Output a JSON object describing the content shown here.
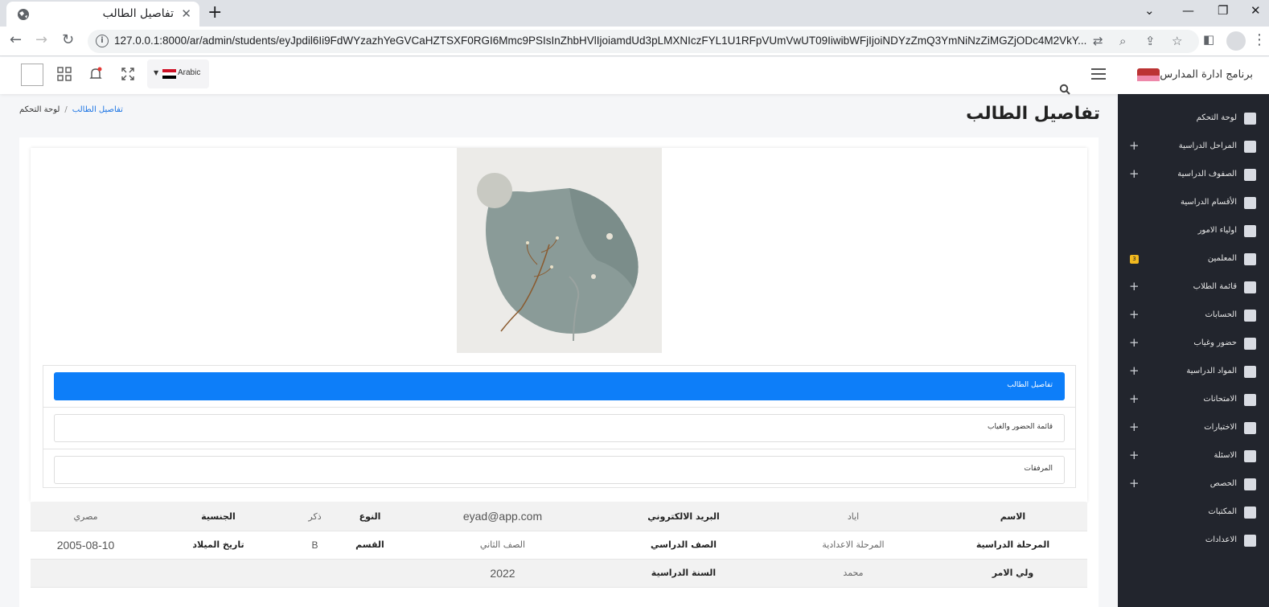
{
  "browser": {
    "tab_title": "تفاصيل الطالب",
    "url": "127.0.0.1:8000/ar/admin/students/eyJpdil6Ii9FdWYzazhYeGVCaHZTSXF0RGI6Mmc9PSIsInZhbHVlIjoiamdUd3pLMXNIczFYL1U1RFpVUmVwUT09IiwibWFjIjoiNDYzZmQ3YmNiNzZiMGZjODc4M2VkY..."
  },
  "header": {
    "brand": "برنامج ادارة المدارس",
    "language": "Arabic"
  },
  "sidebar": {
    "items": [
      {
        "label": "لوحة التحكم",
        "icon": "home-icon",
        "expandable": false,
        "badge": ""
      },
      {
        "label": "المراحل الدراسية",
        "icon": "school-icon",
        "expandable": true,
        "badge": ""
      },
      {
        "label": "الصفوف الدراسية",
        "icon": "building-icon",
        "expandable": true,
        "badge": ""
      },
      {
        "label": "الأقسام الدراسية",
        "icon": "monitor-icon",
        "expandable": false,
        "badge": ""
      },
      {
        "label": "اولياء الامور",
        "icon": "user-icon",
        "expandable": false,
        "badge": ""
      },
      {
        "label": "المعلمين",
        "icon": "teacher-icon",
        "expandable": false,
        "badge": "3"
      },
      {
        "label": "قائمة الطلاب",
        "icon": "students-icon",
        "expandable": true,
        "badge": ""
      },
      {
        "label": "الحسابات",
        "icon": "money-icon",
        "expandable": true,
        "badge": ""
      },
      {
        "label": "حضور وغياب",
        "icon": "calendar-icon",
        "expandable": true,
        "badge": ""
      },
      {
        "label": "المواد الدراسية",
        "icon": "book-open-icon",
        "expandable": true,
        "badge": ""
      },
      {
        "label": "الامتحانات",
        "icon": "book-open-icon",
        "expandable": true,
        "badge": ""
      },
      {
        "label": "الاختبارات",
        "icon": "book-open-icon",
        "expandable": true,
        "badge": ""
      },
      {
        "label": "الاسئلة",
        "icon": "book-icon",
        "expandable": true,
        "badge": ""
      },
      {
        "label": "الحصص",
        "icon": "video-icon",
        "expandable": true,
        "badge": ""
      },
      {
        "label": "المكتبات",
        "icon": "library-icon",
        "expandable": false,
        "badge": ""
      },
      {
        "label": "الاعدادات",
        "icon": "gears-icon",
        "expandable": false,
        "badge": ""
      }
    ]
  },
  "page": {
    "title": "تفاصيل الطالب",
    "breadcrumb": {
      "home": "لوحة التحكم",
      "current": "تفاصيل الطالب"
    }
  },
  "tabs": [
    {
      "label": "تفاصيل الطالب",
      "active": true
    },
    {
      "label": "قائمة الحضور والغياب",
      "active": false
    },
    {
      "label": "المرفقات",
      "active": false
    }
  ],
  "student": {
    "name_label": "الاسم",
    "name": "اياد",
    "email_label": "البريد الالكتروني",
    "email": "eyad@app.com",
    "gender_label": "النوع",
    "gender": "ذكر",
    "nationality_label": "الجنسية",
    "nationality": "مصري",
    "stage_label": "المرحلة الدراسية",
    "stage": "المرحلة الاعدادية",
    "grade_label": "الصف الدراسي",
    "grade": "الصف الثاني",
    "section_label": "القسم",
    "section": "B",
    "birth_label": "تاريخ الميلاد",
    "birth": "2005-08-10",
    "parent_label": "ولي الامر",
    "parent": "محمد",
    "year_label": "السنة الدراسية",
    "year": "2022"
  },
  "colors": {
    "sidebar_bg": "#22252d",
    "active_tab": "#0d7ef9",
    "badge": "#f2b91f"
  }
}
